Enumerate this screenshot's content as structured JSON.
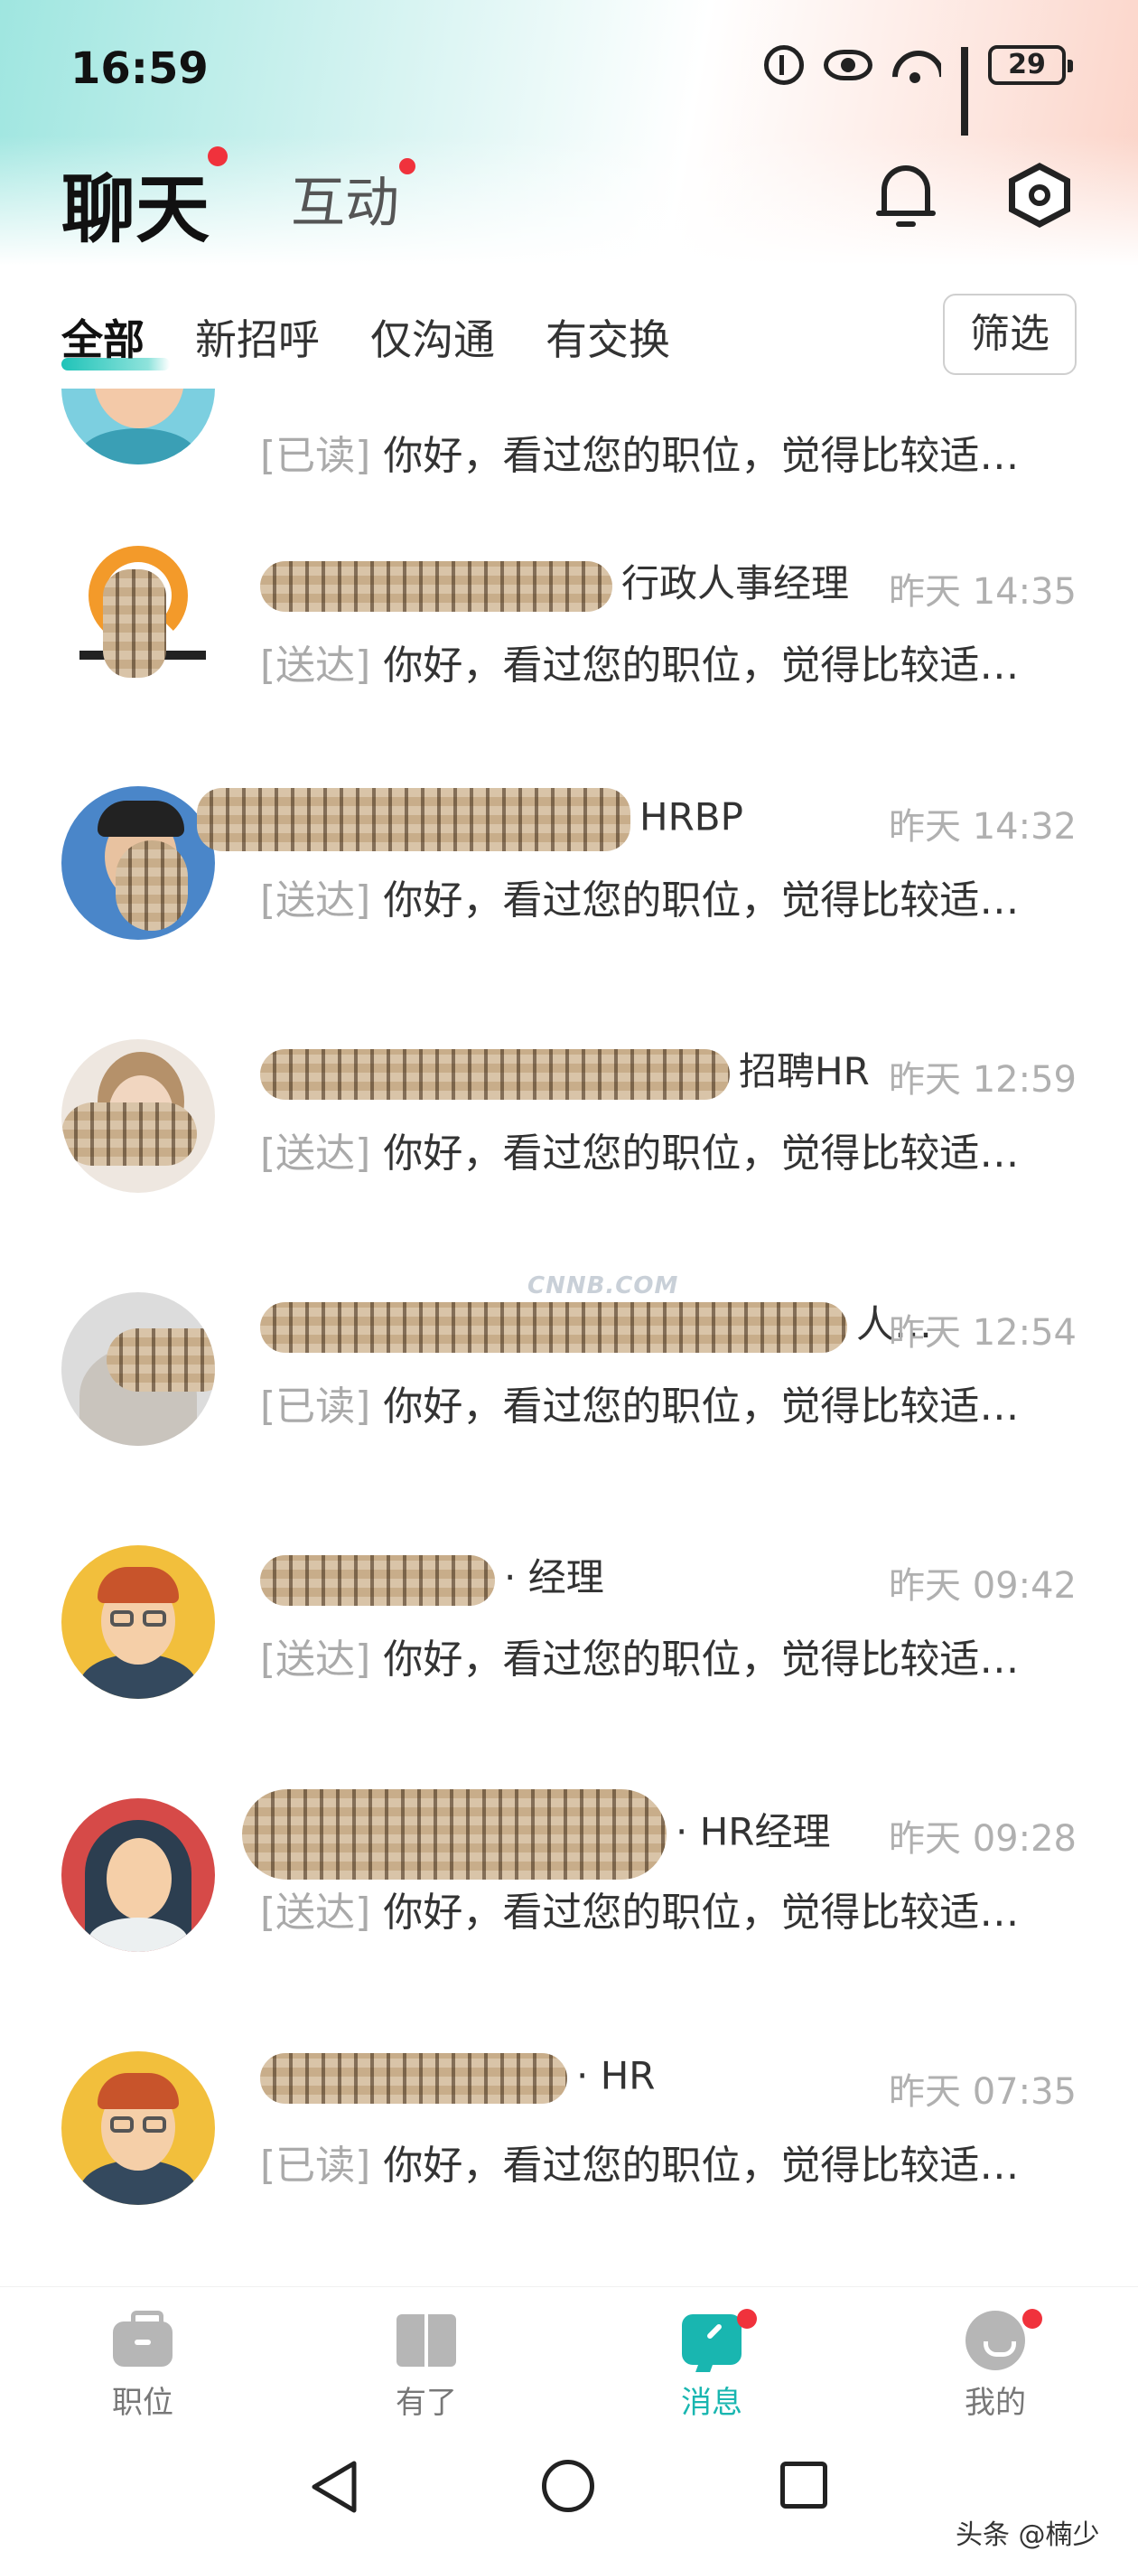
{
  "status_bar": {
    "time": "16:59",
    "battery": "29"
  },
  "header": {
    "chat_tab": "聊天",
    "interact_tab": "互动"
  },
  "filters": {
    "tabs": [
      "全部",
      "新招呼",
      "仅沟通",
      "有交换"
    ],
    "filter_button": "筛选"
  },
  "colors": {
    "accent": "#19b6b0",
    "badge": "#f0323c"
  },
  "conversations": [
    {
      "name_suffix": "",
      "time": "",
      "status": "[已读]",
      "message": "你好，看过您的职位，觉得比较适…"
    },
    {
      "name_suffix": "行政人事经理",
      "time": "昨天 14:35",
      "status": "[送达]",
      "message": "你好，看过您的职位，觉得比较适…"
    },
    {
      "name_suffix": "HRBP",
      "time": "昨天 14:32",
      "status": "[送达]",
      "message": "你好，看过您的职位，觉得比较适…"
    },
    {
      "name_suffix": "招聘HR",
      "time": "昨天 12:59",
      "status": "[送达]",
      "message": "你好，看过您的职位，觉得比较适…"
    },
    {
      "name_suffix": "人…",
      "time": "昨天 12:54",
      "status": "[已读]",
      "message": "你好，看过您的职位，觉得比较适…"
    },
    {
      "name_suffix": "· 经理",
      "time": "昨天 09:42",
      "status": "[送达]",
      "message": "你好，看过您的职位，觉得比较适…"
    },
    {
      "name_suffix": "· HR经理",
      "time": "昨天 09:28",
      "status": "[送达]",
      "message": "你好，看过您的职位，觉得比较适…"
    },
    {
      "name_suffix": "· HR",
      "time": "昨天 07:35",
      "status": "[已读]",
      "message": "你好，看过您的职位，觉得比较适…"
    }
  ],
  "watermark": "CNNB.COM",
  "bottom_nav": [
    {
      "label": "职位",
      "icon": "briefcase-icon"
    },
    {
      "label": "有了",
      "icon": "book-icon"
    },
    {
      "label": "消息",
      "icon": "message-icon"
    },
    {
      "label": "我的",
      "icon": "profile-icon"
    }
  ],
  "credit": "头条 @楠少"
}
